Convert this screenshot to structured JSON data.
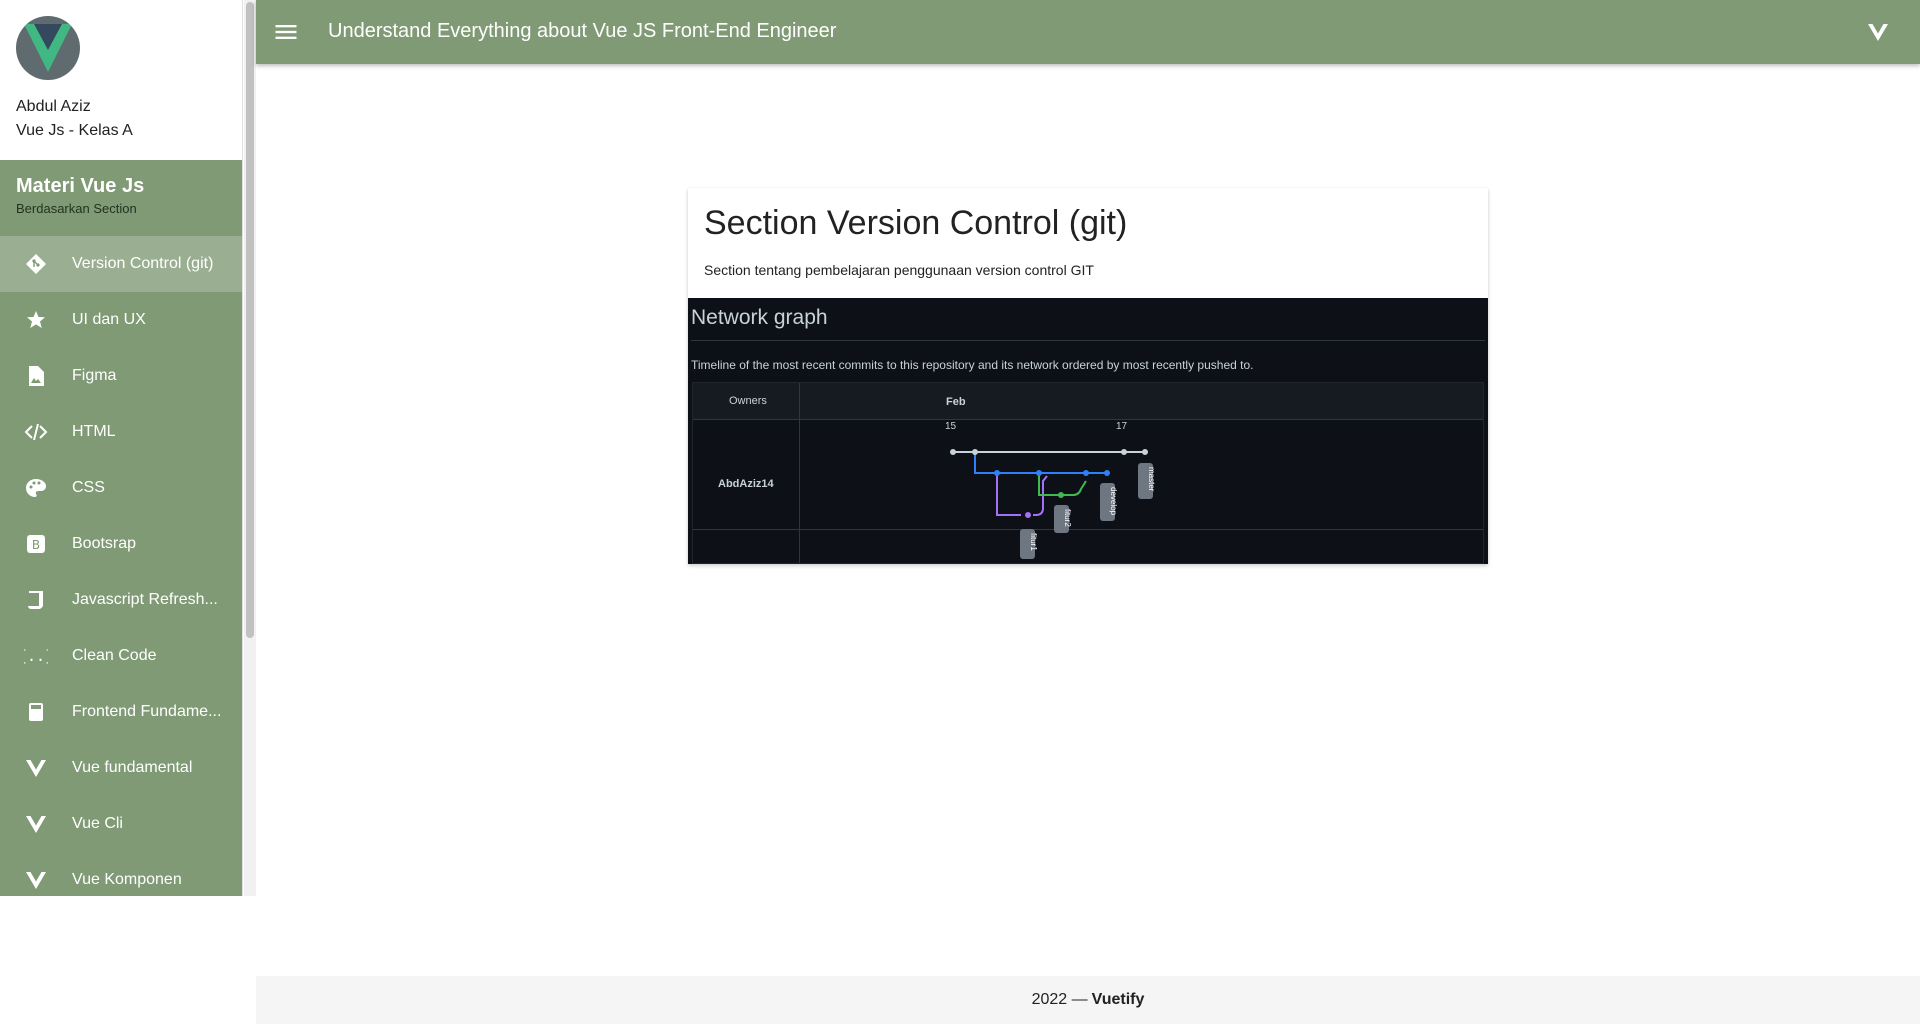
{
  "profile": {
    "name": "Abdul Aziz",
    "subtitle": "Vue Js - Kelas A"
  },
  "menu": {
    "title": "Materi Vue Js",
    "subtitle": "Berdasarkan Section",
    "items": [
      {
        "label": "Version Control (git)",
        "icon": "git-icon",
        "active": true
      },
      {
        "label": "UI dan UX",
        "icon": "star-badge-icon"
      },
      {
        "label": "Figma",
        "icon": "image-file-icon"
      },
      {
        "label": "HTML",
        "icon": "code-tags-icon"
      },
      {
        "label": "CSS",
        "icon": "palette-icon"
      },
      {
        "label": "Bootsrap",
        "icon": "bootstrap-icon"
      },
      {
        "label": "Javascript Refresh...",
        "icon": "script-icon"
      },
      {
        "label": "Clean Code",
        "icon": "code-braces-icon"
      },
      {
        "label": "Frontend Fundame...",
        "icon": "book-icon"
      },
      {
        "label": "Vue fundamental",
        "icon": "vuejs-icon"
      },
      {
        "label": "Vue Cli",
        "icon": "vuejs-icon"
      },
      {
        "label": "Vue Komponen",
        "icon": "vuejs-icon"
      }
    ]
  },
  "appbar": {
    "title": "Understand Everything about Vue JS Front-End Engineer"
  },
  "card": {
    "title": "Section Version Control (git)",
    "text": "Section tentang pembelajaran penggunaan version control GIT"
  },
  "graph": {
    "title": "Network graph",
    "description": "Timeline of the most recent commits to this repository and its network ordered by most recently pushed to.",
    "owners_label": "Owners",
    "month": "Feb",
    "day_ticks": [
      "15",
      "17"
    ],
    "owner": "AbdAziz14",
    "branches": [
      "fitur1",
      "fitur2",
      "develop",
      "master"
    ],
    "colors": {
      "master": "#c9d1d9",
      "develop": "#2f81f7",
      "fitur1": "#a371f7",
      "fitur2": "#3fb950",
      "tag": "#6e7681"
    }
  },
  "footer": {
    "year": "2022 —",
    "brand": "Vuetify"
  },
  "colors": {
    "primary": "#7f9a74",
    "active_item": "#9aae91"
  }
}
